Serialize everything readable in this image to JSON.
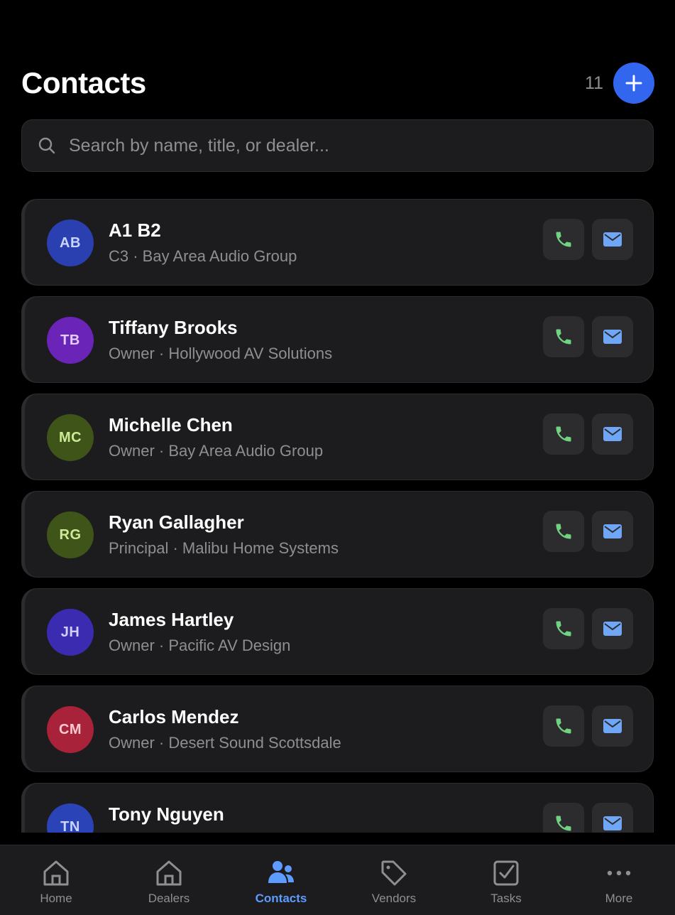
{
  "header": {
    "title": "Contacts",
    "count": "11",
    "add_icon": "plus-icon",
    "accent_color": "#3366ee"
  },
  "search": {
    "placeholder": "Search by name, title, or dealer...",
    "value": "",
    "icon": "search-icon"
  },
  "contacts": [
    {
      "initials": "AB",
      "name": "A1 B2",
      "subtitle": "C3 · Bay Area Audio Group",
      "avatar_bg": "#2a3fb0",
      "avatar_fg": "#c9d4ff"
    },
    {
      "initials": "TB",
      "name": "Tiffany Brooks",
      "subtitle": "Owner · Hollywood AV Solutions",
      "avatar_bg": "#6a24b8",
      "avatar_fg": "#e3ccff"
    },
    {
      "initials": "MC",
      "name": "Michelle Chen",
      "subtitle": "Owner · Bay Area Audio Group",
      "avatar_bg": "#3e5418",
      "avatar_fg": "#cdeb95"
    },
    {
      "initials": "RG",
      "name": "Ryan Gallagher",
      "subtitle": "Principal · Malibu Home Systems",
      "avatar_bg": "#3e5418",
      "avatar_fg": "#cdeb95"
    },
    {
      "initials": "JH",
      "name": "James Hartley",
      "subtitle": "Owner · Pacific AV Design",
      "avatar_bg": "#3a2bb0",
      "avatar_fg": "#cfd0ff"
    },
    {
      "initials": "CM",
      "name": "Carlos Mendez",
      "subtitle": "Owner · Desert Sound Scottsdale",
      "avatar_bg": "#a8223a",
      "avatar_fg": "#ffc9d2"
    },
    {
      "initials": "TN",
      "name": "Tony Nguyen",
      "subtitle": "",
      "avatar_bg": "#2a44b8",
      "avatar_fg": "#c9d4ff"
    }
  ],
  "actions": {
    "call_icon": "phone-icon",
    "email_icon": "mail-icon",
    "call_color": "#6fd37f",
    "email_color": "#6fa6f5"
  },
  "tabbar": {
    "active": "Contacts",
    "active_color": "#5e9bff",
    "items": [
      {
        "label": "Home",
        "icon": "home-icon"
      },
      {
        "label": "Dealers",
        "icon": "store-icon"
      },
      {
        "label": "Contacts",
        "icon": "people-icon"
      },
      {
        "label": "Vendors",
        "icon": "tag-icon"
      },
      {
        "label": "Tasks",
        "icon": "checkbox-icon"
      },
      {
        "label": "More",
        "icon": "more-icon"
      }
    ]
  }
}
